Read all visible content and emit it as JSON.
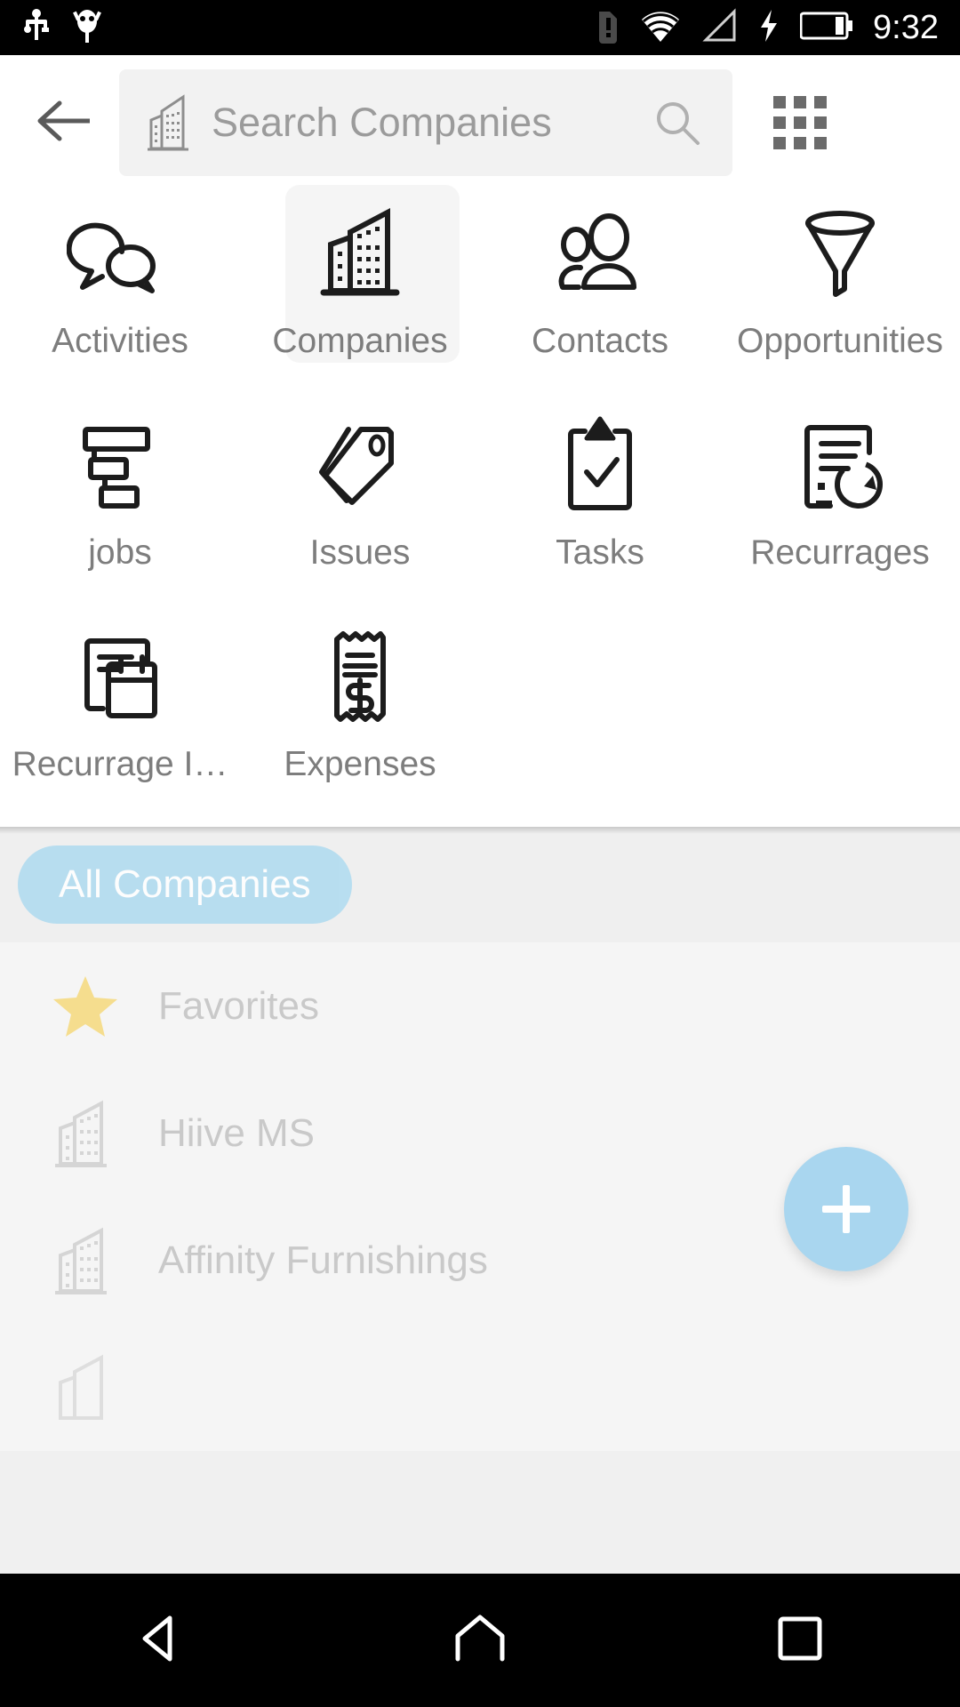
{
  "status_bar": {
    "time": "9:32",
    "icons": [
      "usb-icon",
      "android-debug-icon",
      "sim-alert-icon",
      "wifi-icon",
      "cell-signal-icon",
      "charging-bolt-icon",
      "battery-icon"
    ]
  },
  "app_bar": {
    "back_label": "back-arrow",
    "search_placeholder": "Search Companies",
    "search_value": "",
    "search_icon": "search-icon",
    "leading_icon": "building-icon",
    "apps_grid_icon": "apps-grid-icon"
  },
  "module_grid": {
    "selected": "Companies",
    "items": [
      {
        "label": "Activities",
        "icon": "chat-bubbles-icon",
        "selected": false
      },
      {
        "label": "Companies",
        "icon": "buildings-icon",
        "selected": true
      },
      {
        "label": "Contacts",
        "icon": "people-icon",
        "selected": false
      },
      {
        "label": "Opportunities",
        "icon": "funnel-icon",
        "selected": false
      },
      {
        "label": "jobs",
        "icon": "hierarchy-icon",
        "selected": false
      },
      {
        "label": "Issues",
        "icon": "tags-icon",
        "selected": false
      },
      {
        "label": "Tasks",
        "icon": "clipboard-check-icon",
        "selected": false
      },
      {
        "label": "Recurrages",
        "icon": "document-refresh-icon",
        "selected": false
      },
      {
        "label": "Recurrage I…",
        "icon": "document-calendar-icon",
        "selected": false
      },
      {
        "label": "Expenses",
        "icon": "receipt-dollar-icon",
        "selected": false
      }
    ]
  },
  "filter_chip": {
    "label": "All Companies",
    "color": "#b3dcf0"
  },
  "company_list": [
    {
      "label": "Favorites",
      "icon": "star-icon"
    },
    {
      "label": "Hiive MS",
      "icon": "building-outline-icon"
    },
    {
      "label": "Affinity Furnishings",
      "icon": "building-outline-icon"
    }
  ],
  "fab": {
    "icon": "plus-icon",
    "color": "#a9d6ef"
  },
  "nav_bar": {
    "back": "triangle-back-icon",
    "home": "home-icon",
    "recents": "square-recents-icon"
  }
}
